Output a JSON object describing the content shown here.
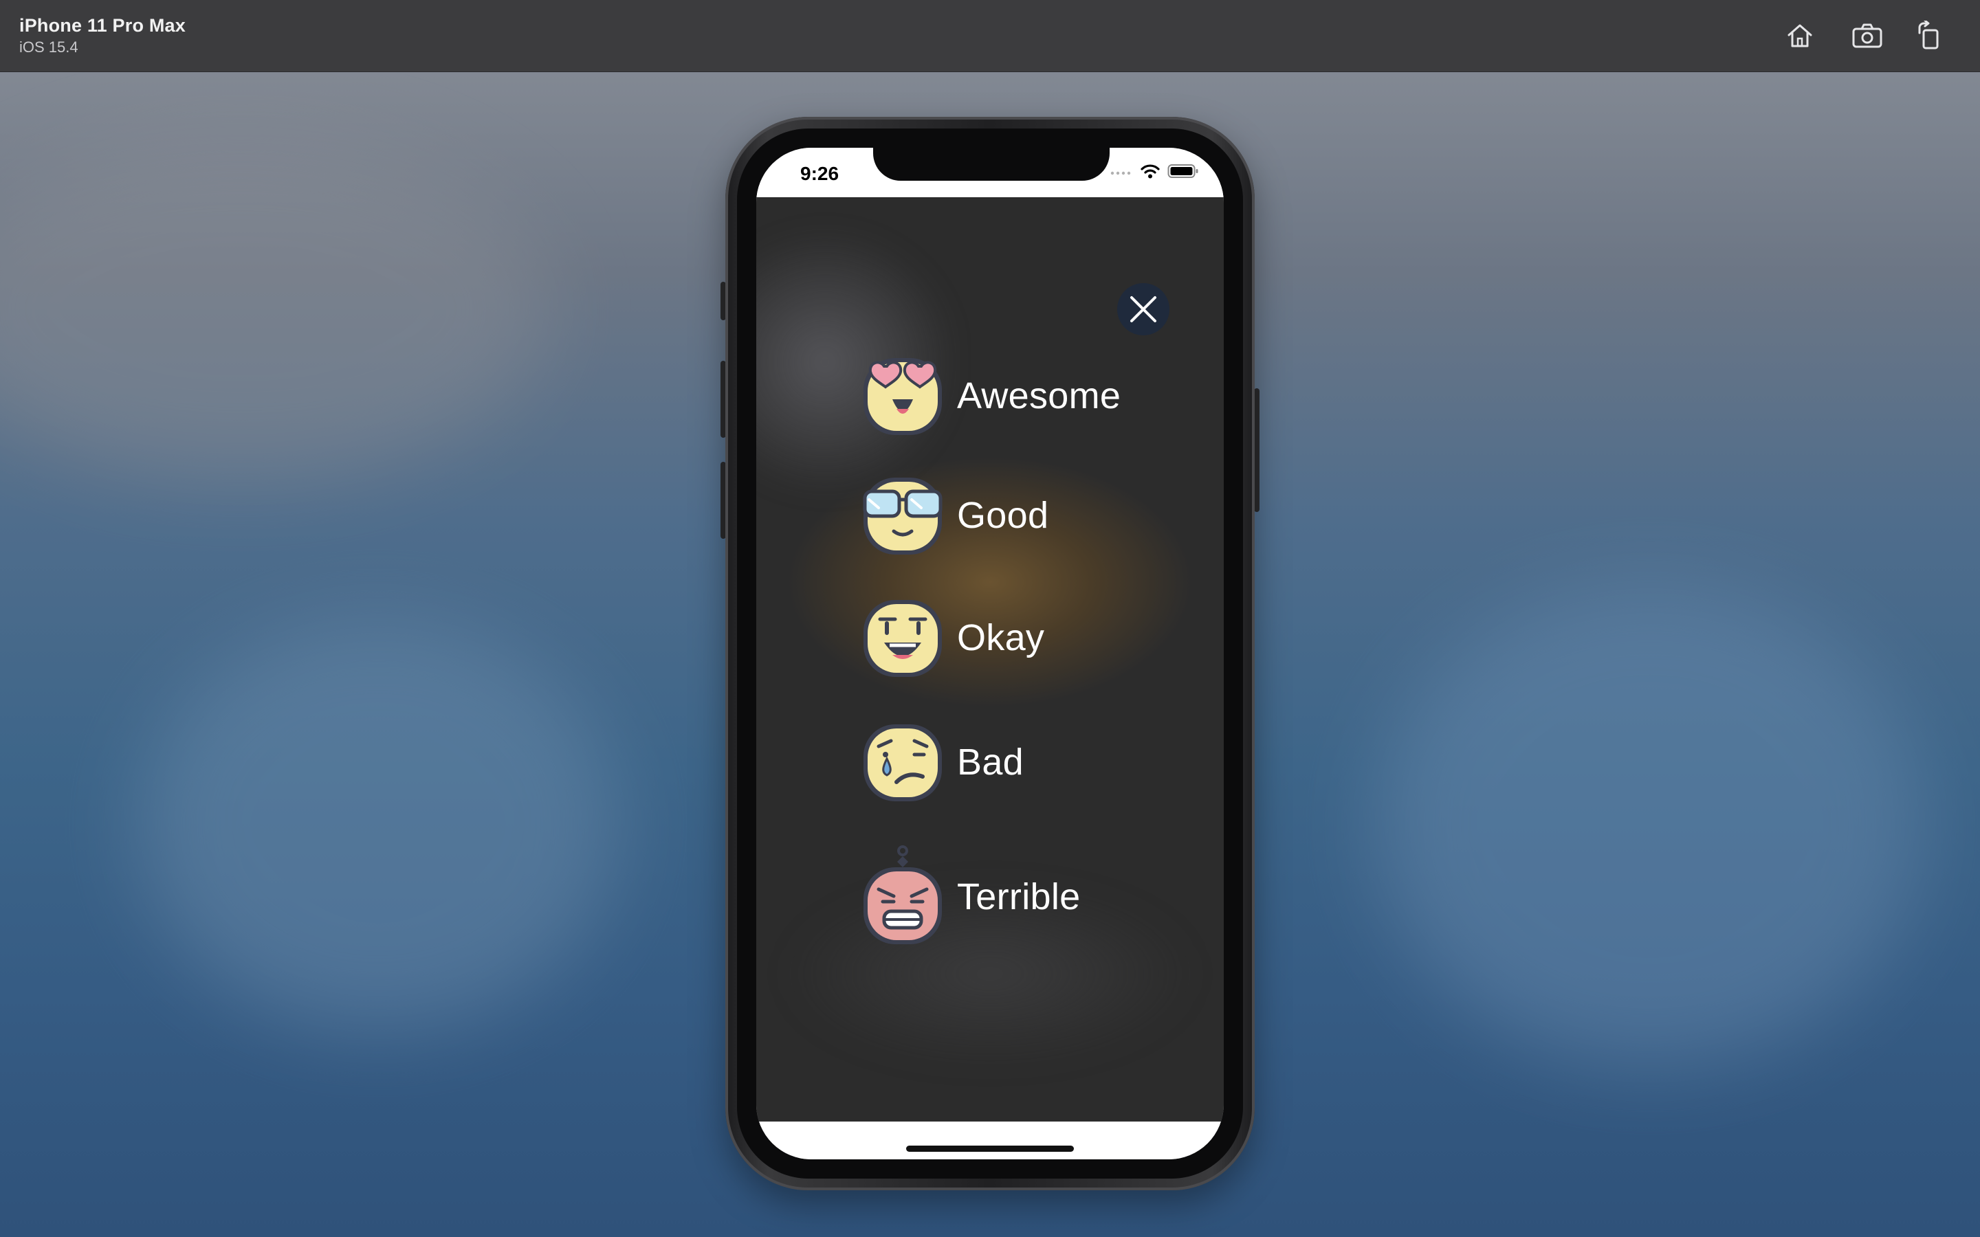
{
  "simulator": {
    "device_name": "iPhone 11 Pro Max",
    "os_version": "iOS 15.4",
    "toolbar_icons": [
      "home-icon",
      "screenshot-camera-icon",
      "rotate-icon"
    ]
  },
  "status_bar": {
    "time": "9:26",
    "icons": [
      "cellular-icon",
      "wifi-icon",
      "battery-icon"
    ]
  },
  "modal": {
    "close_icon": "close-icon",
    "moods": [
      {
        "label": "Awesome",
        "icon": "heart-eyes-face-icon"
      },
      {
        "label": "Good",
        "icon": "sunglasses-face-icon"
      },
      {
        "label": "Okay",
        "icon": "neutral-open-mouth-face-icon"
      },
      {
        "label": "Bad",
        "icon": "crying-face-icon"
      },
      {
        "label": "Terrible",
        "icon": "angry-face-icon"
      }
    ]
  },
  "colors": {
    "titlebar": "#3c3c3e",
    "close_button": "#1f2a3c",
    "face_yellow": "#f4e7a3",
    "face_red": "#e8a3a0",
    "outline": "#3c4050"
  }
}
